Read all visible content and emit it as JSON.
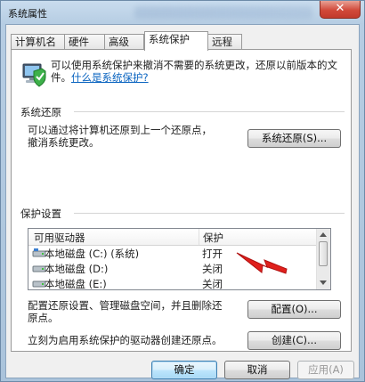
{
  "window": {
    "title": "系统属性",
    "close_glyph": "✕"
  },
  "tabs": [
    {
      "label": "计算机名"
    },
    {
      "label": "硬件"
    },
    {
      "label": "高级"
    },
    {
      "label": "系统保护",
      "active": true
    },
    {
      "label": "远程"
    }
  ],
  "intro": {
    "icon": "computer-shield-icon",
    "text": "可以使用系统保护来撤消不需要的系统更改，还原以前版本的文件。",
    "link": "什么是系统保护?"
  },
  "restore": {
    "section_title": "系统还原",
    "description_line1": "可以通过将计算机还原到上一个还原点，",
    "description_line2": "撤消系统更改。",
    "button_label": "系统还原(S)..."
  },
  "protection": {
    "section_title": "保护设置",
    "columns": {
      "drive": "可用驱动器",
      "state": "保护"
    },
    "rows": [
      {
        "name": "本地磁盘  (C:) (系统)",
        "state": "打开",
        "icon": "system-drive-icon"
      },
      {
        "name": "本地磁盘  (D:)",
        "state": "关闭",
        "icon": "drive-icon"
      },
      {
        "name": "本地磁盘  (E:)",
        "state": "关闭",
        "icon": "drive-icon"
      }
    ],
    "configure_text_line1": "配置还原设置、管理磁盘空间，并且删除还",
    "configure_text_line2": "原点。",
    "configure_button": "配置(O)...",
    "create_text": "立刻为启用系统保护的驱动器创建还原点。",
    "create_button": "创建(C)..."
  },
  "footer": {
    "ok": "确定",
    "cancel": "取消",
    "apply": "应用(A)"
  },
  "colors": {
    "link": "#0a64c0",
    "close_red": "#d1493a",
    "title_bg": "#b6cde3"
  }
}
